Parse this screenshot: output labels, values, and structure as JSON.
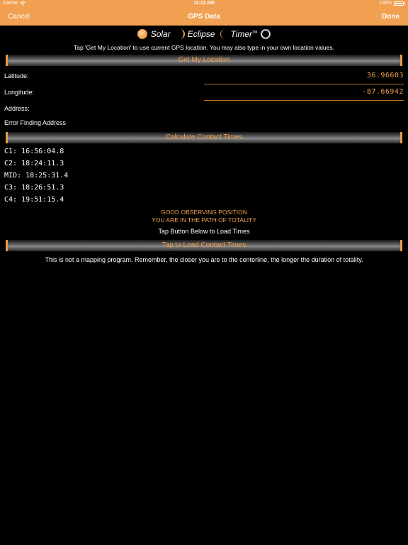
{
  "status_bar": {
    "carrier": "Carrier",
    "time": "11:11 AM",
    "battery": "100%"
  },
  "nav": {
    "cancel": "Cancel",
    "title": "GPS Data",
    "done": "Done"
  },
  "logo": {
    "word1": "Solar",
    "word2": "Eclipse",
    "word3": "Timer",
    "tm": "TM"
  },
  "hint": "Tap 'Get My Location' to use current GPS location. You may also type in your own location values.",
  "buttons": {
    "get_location": "Get My Location",
    "calculate": "Calculate Contact Times",
    "load_times": "Tap to Load Contact Times"
  },
  "location": {
    "latitude_label": "Latitude:",
    "latitude_value": "36.96603",
    "longitude_label": "Longitude:",
    "longitude_value": "-87.66942",
    "address_label": "Address:",
    "address_error": "Error Finding Address"
  },
  "contacts": [
    "C1: 16:56:04.8",
    "C2: 18:24:11.3",
    "MID: 18:25:31.4",
    "C3: 18:26:51.3",
    "C4: 19:51:15.4"
  ],
  "position_status": {
    "line1": "GOOD OBSERVING POSITION",
    "line2": "YOU ARE IN THE PATH OF TOTALITY"
  },
  "load_hint": "Tap Button Below to Load Times",
  "footer_note": "This is not a mapping program. Remember, the closer you are to the centerline, the longer the duration of totality.",
  "colors": {
    "accent": "#f0a050",
    "background": "#000000",
    "nav_bar": "#f0a050"
  },
  "icons": [
    "wifi-icon",
    "battery-icon",
    "sun-icon",
    "crescent-icon",
    "eclipse-ring-icon"
  ]
}
